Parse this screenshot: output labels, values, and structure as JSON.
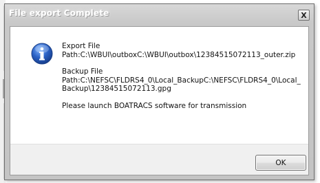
{
  "dialog": {
    "title": "File export Complete",
    "close_label": "X",
    "icon": "info-icon",
    "messages": [
      "Export File\nPath:C:\\WBUI\\outboxC:\\WBUI\\outbox\\12384515072113_outer.zip",
      "Backup File\nPath:C:\\NEFSC\\FLDRS4_0\\Local_BackupC:\\NEFSC\\FLDRS4_0\\Local_Backup\\12384515072113.gpg",
      "Please launch BOATRACS software for transmission"
    ],
    "ok_label": "OK"
  },
  "colors": {
    "info_blue": "#2b62c6",
    "title_text": "#ffffff"
  }
}
